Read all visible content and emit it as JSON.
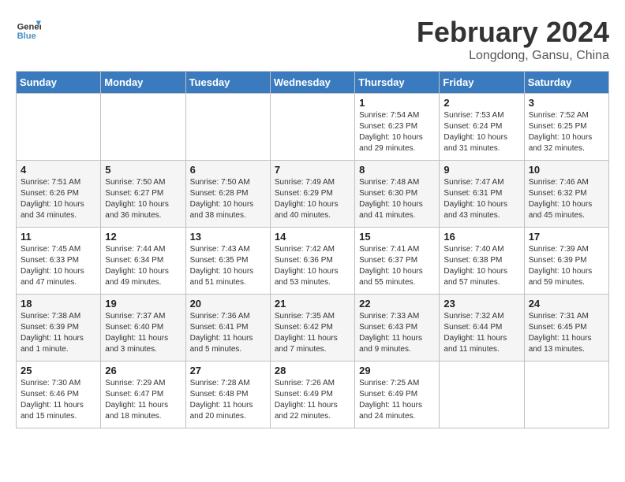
{
  "header": {
    "logo_line1": "General",
    "logo_line2": "Blue",
    "month": "February 2024",
    "location": "Longdong, Gansu, China"
  },
  "weekdays": [
    "Sunday",
    "Monday",
    "Tuesday",
    "Wednesday",
    "Thursday",
    "Friday",
    "Saturday"
  ],
  "weeks": [
    [
      {
        "day": "",
        "info": ""
      },
      {
        "day": "",
        "info": ""
      },
      {
        "day": "",
        "info": ""
      },
      {
        "day": "",
        "info": ""
      },
      {
        "day": "1",
        "info": "Sunrise: 7:54 AM\nSunset: 6:23 PM\nDaylight: 10 hours\nand 29 minutes."
      },
      {
        "day": "2",
        "info": "Sunrise: 7:53 AM\nSunset: 6:24 PM\nDaylight: 10 hours\nand 31 minutes."
      },
      {
        "day": "3",
        "info": "Sunrise: 7:52 AM\nSunset: 6:25 PM\nDaylight: 10 hours\nand 32 minutes."
      }
    ],
    [
      {
        "day": "4",
        "info": "Sunrise: 7:51 AM\nSunset: 6:26 PM\nDaylight: 10 hours\nand 34 minutes."
      },
      {
        "day": "5",
        "info": "Sunrise: 7:50 AM\nSunset: 6:27 PM\nDaylight: 10 hours\nand 36 minutes."
      },
      {
        "day": "6",
        "info": "Sunrise: 7:50 AM\nSunset: 6:28 PM\nDaylight: 10 hours\nand 38 minutes."
      },
      {
        "day": "7",
        "info": "Sunrise: 7:49 AM\nSunset: 6:29 PM\nDaylight: 10 hours\nand 40 minutes."
      },
      {
        "day": "8",
        "info": "Sunrise: 7:48 AM\nSunset: 6:30 PM\nDaylight: 10 hours\nand 41 minutes."
      },
      {
        "day": "9",
        "info": "Sunrise: 7:47 AM\nSunset: 6:31 PM\nDaylight: 10 hours\nand 43 minutes."
      },
      {
        "day": "10",
        "info": "Sunrise: 7:46 AM\nSunset: 6:32 PM\nDaylight: 10 hours\nand 45 minutes."
      }
    ],
    [
      {
        "day": "11",
        "info": "Sunrise: 7:45 AM\nSunset: 6:33 PM\nDaylight: 10 hours\nand 47 minutes."
      },
      {
        "day": "12",
        "info": "Sunrise: 7:44 AM\nSunset: 6:34 PM\nDaylight: 10 hours\nand 49 minutes."
      },
      {
        "day": "13",
        "info": "Sunrise: 7:43 AM\nSunset: 6:35 PM\nDaylight: 10 hours\nand 51 minutes."
      },
      {
        "day": "14",
        "info": "Sunrise: 7:42 AM\nSunset: 6:36 PM\nDaylight: 10 hours\nand 53 minutes."
      },
      {
        "day": "15",
        "info": "Sunrise: 7:41 AM\nSunset: 6:37 PM\nDaylight: 10 hours\nand 55 minutes."
      },
      {
        "day": "16",
        "info": "Sunrise: 7:40 AM\nSunset: 6:38 PM\nDaylight: 10 hours\nand 57 minutes."
      },
      {
        "day": "17",
        "info": "Sunrise: 7:39 AM\nSunset: 6:39 PM\nDaylight: 10 hours\nand 59 minutes."
      }
    ],
    [
      {
        "day": "18",
        "info": "Sunrise: 7:38 AM\nSunset: 6:39 PM\nDaylight: 11 hours\nand 1 minute."
      },
      {
        "day": "19",
        "info": "Sunrise: 7:37 AM\nSunset: 6:40 PM\nDaylight: 11 hours\nand 3 minutes."
      },
      {
        "day": "20",
        "info": "Sunrise: 7:36 AM\nSunset: 6:41 PM\nDaylight: 11 hours\nand 5 minutes."
      },
      {
        "day": "21",
        "info": "Sunrise: 7:35 AM\nSunset: 6:42 PM\nDaylight: 11 hours\nand 7 minutes."
      },
      {
        "day": "22",
        "info": "Sunrise: 7:33 AM\nSunset: 6:43 PM\nDaylight: 11 hours\nand 9 minutes."
      },
      {
        "day": "23",
        "info": "Sunrise: 7:32 AM\nSunset: 6:44 PM\nDaylight: 11 hours\nand 11 minutes."
      },
      {
        "day": "24",
        "info": "Sunrise: 7:31 AM\nSunset: 6:45 PM\nDaylight: 11 hours\nand 13 minutes."
      }
    ],
    [
      {
        "day": "25",
        "info": "Sunrise: 7:30 AM\nSunset: 6:46 PM\nDaylight: 11 hours\nand 15 minutes."
      },
      {
        "day": "26",
        "info": "Sunrise: 7:29 AM\nSunset: 6:47 PM\nDaylight: 11 hours\nand 18 minutes."
      },
      {
        "day": "27",
        "info": "Sunrise: 7:28 AM\nSunset: 6:48 PM\nDaylight: 11 hours\nand 20 minutes."
      },
      {
        "day": "28",
        "info": "Sunrise: 7:26 AM\nSunset: 6:49 PM\nDaylight: 11 hours\nand 22 minutes."
      },
      {
        "day": "29",
        "info": "Sunrise: 7:25 AM\nSunset: 6:49 PM\nDaylight: 11 hours\nand 24 minutes."
      },
      {
        "day": "",
        "info": ""
      },
      {
        "day": "",
        "info": ""
      }
    ]
  ]
}
